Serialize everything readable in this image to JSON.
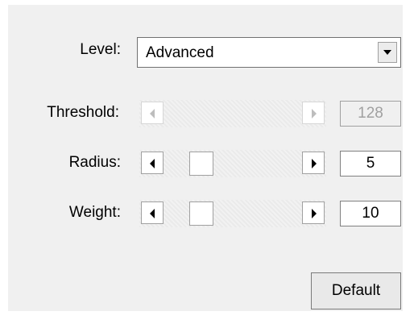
{
  "level": {
    "label": "Level:",
    "value": "Advanced"
  },
  "threshold": {
    "label": "Threshold:",
    "value": "128",
    "enabled": false
  },
  "radius": {
    "label": "Radius:",
    "value": "5"
  },
  "weight": {
    "label": "Weight:",
    "value": "10"
  },
  "buttons": {
    "default_label": "Default"
  },
  "icons": {
    "dropdown": "chevron-down-icon",
    "left_arrow": "left-arrow-icon",
    "right_arrow": "right-arrow-icon"
  }
}
